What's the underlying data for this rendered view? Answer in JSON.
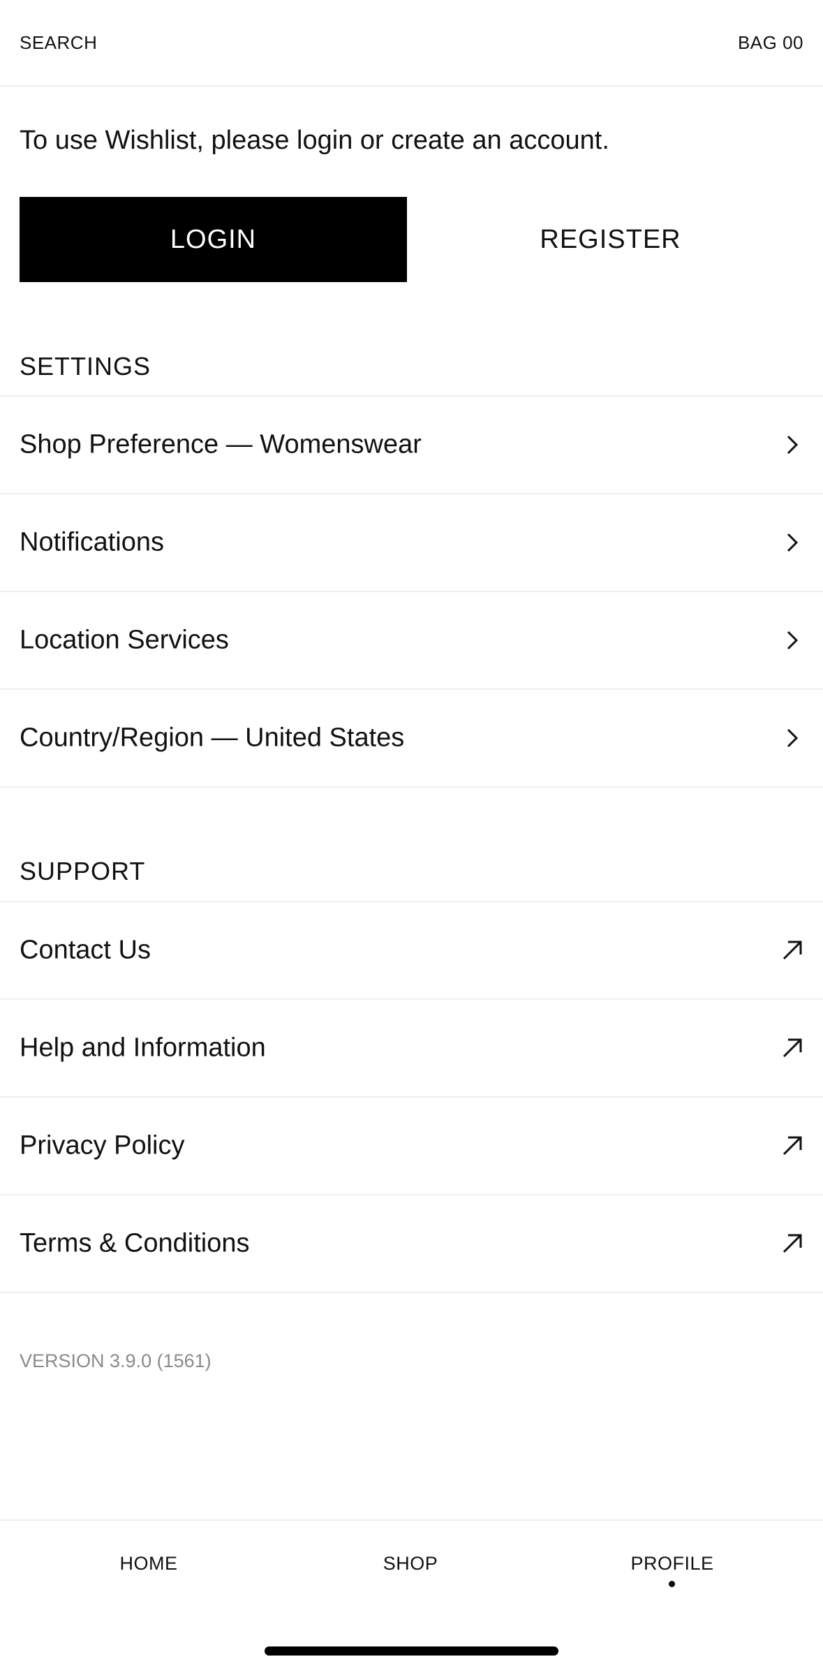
{
  "header": {
    "search_label": "SEARCH",
    "bag_label": "BAG 00"
  },
  "intro": {
    "text": "To use Wishlist, please login or create an account."
  },
  "auth": {
    "login_label": "LOGIN",
    "register_label": "REGISTER"
  },
  "settings": {
    "title": "SETTINGS",
    "items": [
      {
        "label": "Shop Preference — Womenswear",
        "icon": "chevron-right-icon"
      },
      {
        "label": "Notifications",
        "icon": "chevron-right-icon"
      },
      {
        "label": "Location Services",
        "icon": "chevron-right-icon"
      },
      {
        "label": "Country/Region — United States",
        "icon": "chevron-right-icon"
      }
    ]
  },
  "support": {
    "title": "SUPPORT",
    "items": [
      {
        "label": "Contact Us",
        "icon": "external-arrow-icon"
      },
      {
        "label": "Help and Information",
        "icon": "external-arrow-icon"
      },
      {
        "label": "Privacy Policy",
        "icon": "external-arrow-icon"
      },
      {
        "label": "Terms & Conditions",
        "icon": "external-arrow-icon"
      }
    ]
  },
  "footer": {
    "version": "VERSION 3.9.0 (1561)"
  },
  "tabbar": {
    "home": "HOME",
    "shop": "SHOP",
    "profile": "PROFILE",
    "active": "PROFILE"
  },
  "colors": {
    "primary": "#000000",
    "background": "#ffffff",
    "divider": "#efefef",
    "muted": "#8a8a8a"
  }
}
